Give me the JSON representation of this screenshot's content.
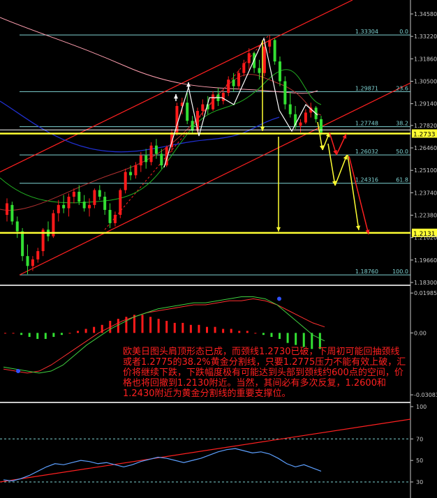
{
  "colors": {
    "bg": "#000000",
    "bull": "#ff1a1a",
    "bear": "#33e033",
    "fib": "#7fd4d4",
    "yellow": "#ffff33",
    "red_line": "#ff2020",
    "white": "#ffffff",
    "ma_blue": "#2030d0",
    "ma_pink": "#ff9fb0",
    "macd_line": "#ff3030",
    "signal_line": "#40d040",
    "rsi_line": "#5da0ff",
    "grid": "#c8c8c8"
  },
  "chart_data": [
    {
      "type": "candlestick",
      "panel": "price",
      "y_axis_ticks": [
        "1.34580",
        "1.33220",
        "1.31860",
        "1.30500",
        "1.29140",
        "1.27820",
        "1.26460",
        "1.25100",
        "1.23740",
        "1.22380",
        "1.21020",
        "1.19660",
        "1.18300"
      ],
      "ylim": [
        1.183,
        1.3458
      ],
      "fibonacci_levels": [
        {
          "price": "1.33304",
          "pct": "0.0"
        },
        {
          "price": "1.29871",
          "pct": "23.6"
        },
        {
          "price": "1.27748",
          "pct": "38.2"
        },
        {
          "price": "1.26032",
          "pct": "50.0"
        },
        {
          "price": "1.24316",
          "pct": "61.8"
        },
        {
          "price": "1.18760",
          "pct": "100.0"
        }
      ],
      "horizontal_levels": [
        {
          "label": "1.2733",
          "price": 1.2733
        },
        {
          "label": "1.2131",
          "price": 1.2131
        }
      ],
      "neckline_price": 1.2755,
      "candles": [
        [
          1.224,
          1.234,
          1.22,
          1.231
        ],
        [
          1.23,
          1.232,
          1.218,
          1.22
        ],
        [
          1.22,
          1.223,
          1.21,
          1.214
        ],
        [
          1.214,
          1.216,
          1.196,
          1.199
        ],
        [
          1.199,
          1.206,
          1.188,
          1.193
        ],
        [
          1.193,
          1.199,
          1.19,
          1.197
        ],
        [
          1.197,
          1.204,
          1.195,
          1.202
        ],
        [
          1.202,
          1.216,
          1.199,
          1.215
        ],
        [
          1.215,
          1.22,
          1.208,
          1.211
        ],
        [
          1.211,
          1.227,
          1.21,
          1.225
        ],
        [
          1.225,
          1.233,
          1.22,
          1.23
        ],
        [
          1.23,
          1.236,
          1.225,
          1.228
        ],
        [
          1.228,
          1.237,
          1.223,
          1.235
        ],
        [
          1.235,
          1.24,
          1.231,
          1.238
        ],
        [
          1.238,
          1.242,
          1.23,
          1.232
        ],
        [
          1.232,
          1.236,
          1.226,
          1.228
        ],
        [
          1.228,
          1.234,
          1.223,
          1.23
        ],
        [
          1.23,
          1.24,
          1.228,
          1.239
        ],
        [
          1.239,
          1.242,
          1.233,
          1.235
        ],
        [
          1.235,
          1.238,
          1.224,
          1.227
        ],
        [
          1.227,
          1.231,
          1.216,
          1.219
        ],
        [
          1.219,
          1.226,
          1.217,
          1.224
        ],
        [
          1.224,
          1.24,
          1.222,
          1.239
        ],
        [
          1.239,
          1.252,
          1.237,
          1.25
        ],
        [
          1.25,
          1.254,
          1.245,
          1.248
        ],
        [
          1.248,
          1.256,
          1.246,
          1.254
        ],
        [
          1.254,
          1.262,
          1.25,
          1.26
        ],
        [
          1.26,
          1.264,
          1.252,
          1.256
        ],
        [
          1.256,
          1.268,
          1.254,
          1.266
        ],
        [
          1.266,
          1.27,
          1.258,
          1.261
        ],
        [
          1.261,
          1.264,
          1.252,
          1.254
        ],
        [
          1.254,
          1.266,
          1.253,
          1.265
        ],
        [
          1.265,
          1.276,
          1.262,
          1.274
        ],
        [
          1.274,
          1.292,
          1.272,
          1.29
        ],
        [
          1.29,
          1.295,
          1.285,
          1.292
        ],
        [
          1.292,
          1.298,
          1.279,
          1.281
        ],
        [
          1.281,
          1.284,
          1.273,
          1.275
        ],
        [
          1.275,
          1.289,
          1.274,
          1.287
        ],
        [
          1.287,
          1.294,
          1.284,
          1.291
        ],
        [
          1.291,
          1.296,
          1.285,
          1.288
        ],
        [
          1.288,
          1.299,
          1.287,
          1.297
        ],
        [
          1.297,
          1.301,
          1.29,
          1.293
        ],
        [
          1.293,
          1.3,
          1.291,
          1.298
        ],
        [
          1.298,
          1.308,
          1.296,
          1.306
        ],
        [
          1.306,
          1.31,
          1.299,
          1.302
        ],
        [
          1.302,
          1.312,
          1.3,
          1.31
        ],
        [
          1.31,
          1.318,
          1.308,
          1.316
        ],
        [
          1.316,
          1.325,
          1.312,
          1.322
        ],
        [
          1.322,
          1.323,
          1.31,
          1.313
        ],
        [
          1.313,
          1.318,
          1.306,
          1.31
        ],
        [
          1.31,
          1.328,
          1.308,
          1.326
        ],
        [
          1.326,
          1.333,
          1.322,
          1.33
        ],
        [
          1.33,
          1.331,
          1.315,
          1.317
        ],
        [
          1.317,
          1.32,
          1.302,
          1.305
        ],
        [
          1.305,
          1.308,
          1.288,
          1.291
        ],
        [
          1.291,
          1.298,
          1.283,
          1.285
        ],
        [
          1.285,
          1.29,
          1.276,
          1.278
        ],
        [
          1.278,
          1.282,
          1.274,
          1.28
        ],
        [
          1.28,
          1.288,
          1.279,
          1.286
        ],
        [
          1.286,
          1.292,
          1.283,
          1.289
        ],
        [
          1.289,
          1.29,
          1.28,
          1.282
        ],
        [
          1.282,
          1.284,
          1.272,
          1.274
        ]
      ]
    },
    {
      "type": "bar",
      "panel": "MACD",
      "y_axis_ticks": [
        "0.019852",
        "0.00",
        "-0.03083"
      ],
      "ylim": [
        -0.0308,
        0.0199
      ],
      "histogram": [
        0.0,
        0.0,
        -0.001,
        -0.002,
        -0.003,
        -0.003,
        -0.002,
        -0.001,
        0.0,
        0.001,
        0.002,
        0.003,
        0.004,
        0.006,
        0.007,
        0.008,
        0.009,
        0.009,
        0.008,
        0.007,
        0.006,
        0.005,
        0.005,
        0.004,
        0.004,
        0.003,
        0.003,
        0.002,
        0.002,
        0.001,
        0.001,
        0.0,
        -0.001,
        -0.002,
        -0.003,
        -0.005,
        -0.006,
        -0.007,
        -0.008,
        -0.008
      ],
      "macd_line": [
        -0.018,
        -0.019,
        -0.02,
        -0.019,
        -0.016,
        -0.012,
        -0.008,
        -0.004,
        0.0,
        0.003,
        0.006,
        0.008,
        0.01,
        0.011,
        0.012,
        0.013,
        0.014,
        0.014,
        0.015,
        0.016,
        0.016,
        0.017,
        0.016,
        0.014,
        0.011,
        0.008,
        0.005,
        0.003
      ],
      "signal_line": [
        -0.017,
        -0.018,
        -0.019,
        -0.02,
        -0.019,
        -0.016,
        -0.011,
        -0.006,
        -0.002,
        0.002,
        0.005,
        0.008,
        0.01,
        0.012,
        0.013,
        0.014,
        0.015,
        0.015,
        0.016,
        0.017,
        0.018,
        0.018,
        0.017,
        0.014,
        0.009,
        0.004,
        -0.001,
        -0.004
      ]
    },
    {
      "type": "line",
      "panel": "RSI",
      "y_axis_ticks": [
        "100",
        "70",
        "50",
        "30"
      ],
      "ylim": [
        22,
        100
      ],
      "rsi": [
        32,
        31,
        33,
        36,
        40,
        44,
        47,
        46,
        48,
        50,
        49,
        47,
        48,
        46,
        44,
        46,
        49,
        51,
        53,
        52,
        50,
        48,
        50,
        52,
        55,
        58,
        60,
        61,
        59,
        57,
        58,
        56,
        52,
        47,
        44,
        46,
        43,
        40
      ]
    }
  ],
  "annotation": {
    "text": "欧美日图头肩顶形态已成，而颈线1.2730已破，下周初可能回抽颈线或者1.2775的38.2%黄金分割线，只要1.2775压力不能有效上破，汇价将继续下跌，下跌幅度极有可能达到头部到颈线约600点的空间，价格也将回撤到1.2130附近。当然，其间必有多次反复，1.2600和1.2430附近为黄金分割线的重要支撑位。"
  }
}
